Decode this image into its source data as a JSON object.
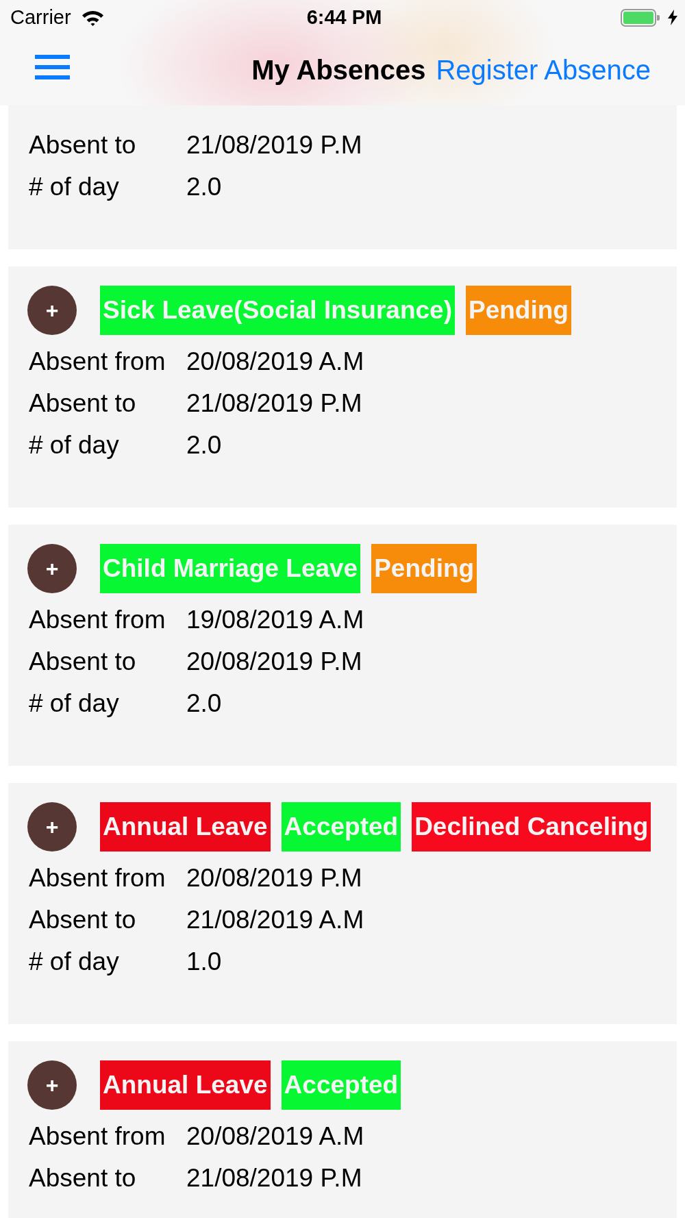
{
  "status_bar": {
    "carrier": "Carrier",
    "time": "6:44 PM"
  },
  "nav_bar": {
    "title": "My Absences",
    "action": "Register Absence"
  },
  "absences": [
    {
      "rows": [
        {
          "label": "Absent to",
          "value": "21/08/2019 P.M"
        },
        {
          "label": "# of day",
          "value": "2.0"
        }
      ]
    },
    {
      "toggle": "+",
      "tags": [
        {
          "text": "Sick Leave(Social Insurance)",
          "color": "#08f733"
        },
        {
          "text": "Pending",
          "color": "#f78b0a"
        }
      ],
      "rows": [
        {
          "label": "Absent from",
          "value": "20/08/2019 A.M"
        },
        {
          "label": "Absent to",
          "value": "21/08/2019 P.M"
        },
        {
          "label": "# of day",
          "value": "2.0"
        }
      ]
    },
    {
      "toggle": "+",
      "tags": [
        {
          "text": "Child Marriage Leave",
          "color": "#08f733"
        },
        {
          "text": "Pending",
          "color": "#f78b0a"
        }
      ],
      "rows": [
        {
          "label": "Absent from",
          "value": "19/08/2019 A.M"
        },
        {
          "label": "Absent to",
          "value": "20/08/2019 P.M"
        },
        {
          "label": "# of day",
          "value": "2.0"
        }
      ]
    },
    {
      "toggle": "+",
      "tags": [
        {
          "text": "Annual Leave",
          "color": "#ec0719"
        },
        {
          "text": "Accepted",
          "color": "#08f733"
        },
        {
          "text": "Declined Canceling",
          "color": "#f70a1d"
        }
      ],
      "rows": [
        {
          "label": "Absent from",
          "value": "20/08/2019 P.M"
        },
        {
          "label": "Absent to",
          "value": "21/08/2019 A.M"
        },
        {
          "label": "# of day",
          "value": "1.0"
        }
      ]
    },
    {
      "toggle": "+",
      "tags": [
        {
          "text": "Annual Leave",
          "color": "#ec0719"
        },
        {
          "text": "Accepted",
          "color": "#08f733"
        }
      ],
      "rows": [
        {
          "label": "Absent from",
          "value": "20/08/2019 A.M"
        },
        {
          "label": "Absent to",
          "value": "21/08/2019 P.M"
        }
      ]
    }
  ]
}
